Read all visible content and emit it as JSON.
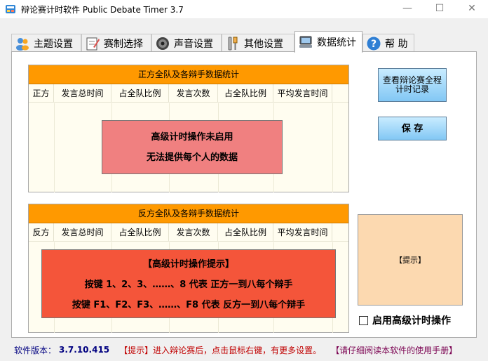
{
  "window": {
    "title": "辩论赛计时软件 Public Debate Timer 3.7"
  },
  "tabs": [
    {
      "label": "主题设置",
      "icon": "people-icon"
    },
    {
      "label": "赛制选择",
      "icon": "notepad-icon"
    },
    {
      "label": "声音设置",
      "icon": "speaker-icon"
    },
    {
      "label": "其他设置",
      "icon": "tools-icon"
    },
    {
      "label": "数据统计",
      "icon": "computer-icon"
    },
    {
      "label": "帮  助",
      "icon": "help-icon"
    }
  ],
  "pro_panel": {
    "header": "正方全队及各辩手数据统计",
    "columns": [
      "正方",
      "发言总时间",
      "占全队比例",
      "发言次数",
      "占全队比例",
      "平均发言时间"
    ],
    "message": [
      "高级计时操作未启用",
      "无法提供每个人的数据"
    ]
  },
  "con_panel": {
    "header": "反方全队及各辩手数据统计",
    "columns": [
      "反方",
      "发言总时间",
      "占全队比例",
      "发言次数",
      "占全队比例",
      "平均发言时间"
    ],
    "message": [
      "【高级计时操作提示】",
      "按键 1、2、3、……、8 代表 正方一到八每个辩手",
      "按键 F1、F2、F3、……、F8 代表 反方一到八每个辩手"
    ]
  },
  "buttons": {
    "view_record": "查看辩论赛全程计时记录",
    "save": "保  存"
  },
  "hint": {
    "text": "【提示】"
  },
  "checkbox": {
    "label": "启用高级计时操作",
    "checked": false
  },
  "status": {
    "version_label": "软件版本：",
    "version": "3.7.10.415",
    "tip": "【提示】进入辩论赛后，点击鼠标右键，有更多设置。",
    "manual": "【请仔细阅读本软件的使用手册】"
  },
  "colors": {
    "orange_header": "#ff9900",
    "pro_message_bg": "#f08080",
    "con_message_bg": "#f4553a",
    "hint_bg": "#fcd9b0",
    "accent_blue": "#0000b0",
    "status_red": "#cc0000"
  }
}
